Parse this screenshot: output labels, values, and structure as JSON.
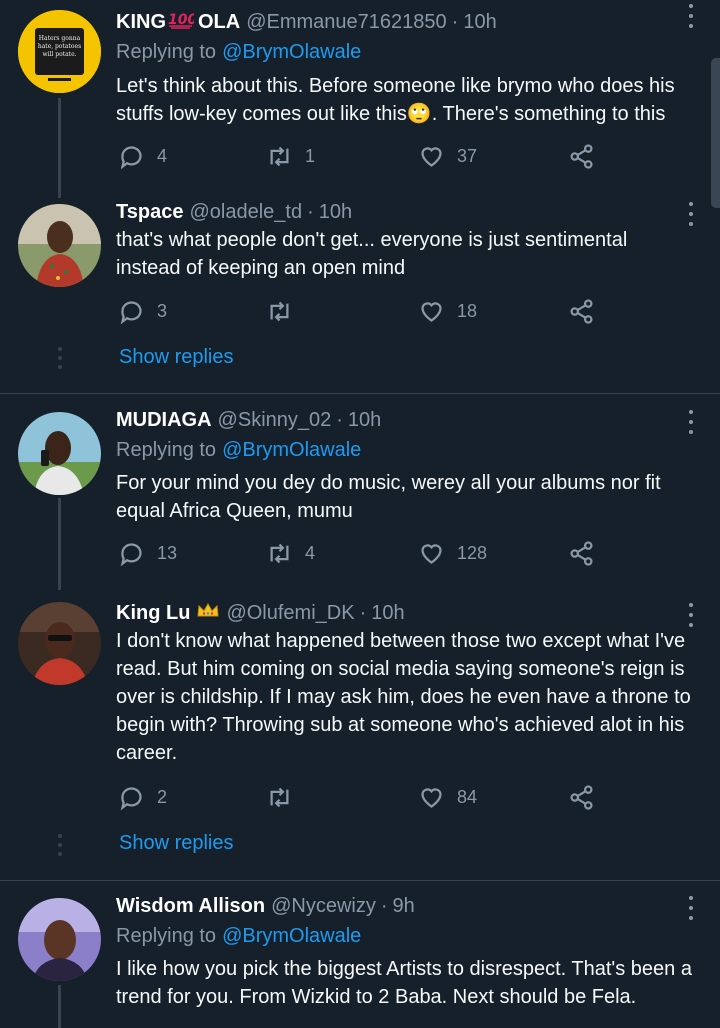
{
  "tweets": [
    {
      "name": "KING",
      "name_suffix": "OLA",
      "badge": "100-emoji",
      "handle": "@Emmanue71621850",
      "time": "10h",
      "replying_label": "Replying to",
      "replying_to": "@BrymOlawale",
      "lines": [
        "Let's think about this. Before someone like brymo who does his",
        "stuffs low-key comes out like this🙄. There's something to this"
      ],
      "reply_count": "4",
      "retweet_count": "1",
      "like_count": "37",
      "avatar_text": [
        "Haters gonna",
        "hate, potatoes",
        "will potate."
      ]
    },
    {
      "name": "Tspace",
      "handle": "@oladele_td",
      "time": "10h",
      "lines": [
        "that's  what people don't get... everyone is just sentimental",
        "instead of keeping an open mind"
      ],
      "reply_count": "3",
      "retweet_count": "",
      "like_count": "18",
      "show_replies": "Show replies"
    },
    {
      "name": "MUDIAGA",
      "handle": "@Skinny_02",
      "time": "10h",
      "replying_label": "Replying to",
      "replying_to": "@BrymOlawale",
      "lines": [
        "For your mind you dey do music, werey all your albums nor fit",
        "equal Africa Queen, mumu"
      ],
      "reply_count": "13",
      "retweet_count": "4",
      "like_count": "128"
    },
    {
      "name": "King Lu",
      "badge": "crown-emoji",
      "handle": "@Olufemi_DK",
      "time": "10h",
      "lines": [
        "I don't know what happened between those two except what I've",
        "read. But him coming on social media saying someone's reign is",
        "over is childship. If I may ask him, does he even have a throne to",
        "begin with? Throwing sub at someone who's achieved alot in his",
        "career."
      ],
      "reply_count": "2",
      "retweet_count": "",
      "like_count": "84",
      "show_replies": "Show replies"
    },
    {
      "name": "Wisdom Allison",
      "handle": "@Nycewizy",
      "time": "9h",
      "replying_label": "Replying to",
      "replying_to": "@BrymOlawale",
      "lines": [
        "I like how you pick the biggest Artists to disrespect. That's been a",
        "trend for you. From Wizkid to 2 Baba. Next should be Fela."
      ]
    }
  ],
  "colors": {
    "background": "#15202b",
    "secondary_text": "#8b98a5",
    "link": "#1d9bf0",
    "divider": "#38444d"
  },
  "icons": {
    "reply": "reply-icon",
    "retweet": "retweet-icon",
    "like": "heart-icon",
    "share": "share-icon",
    "more": "more-options-icon"
  }
}
